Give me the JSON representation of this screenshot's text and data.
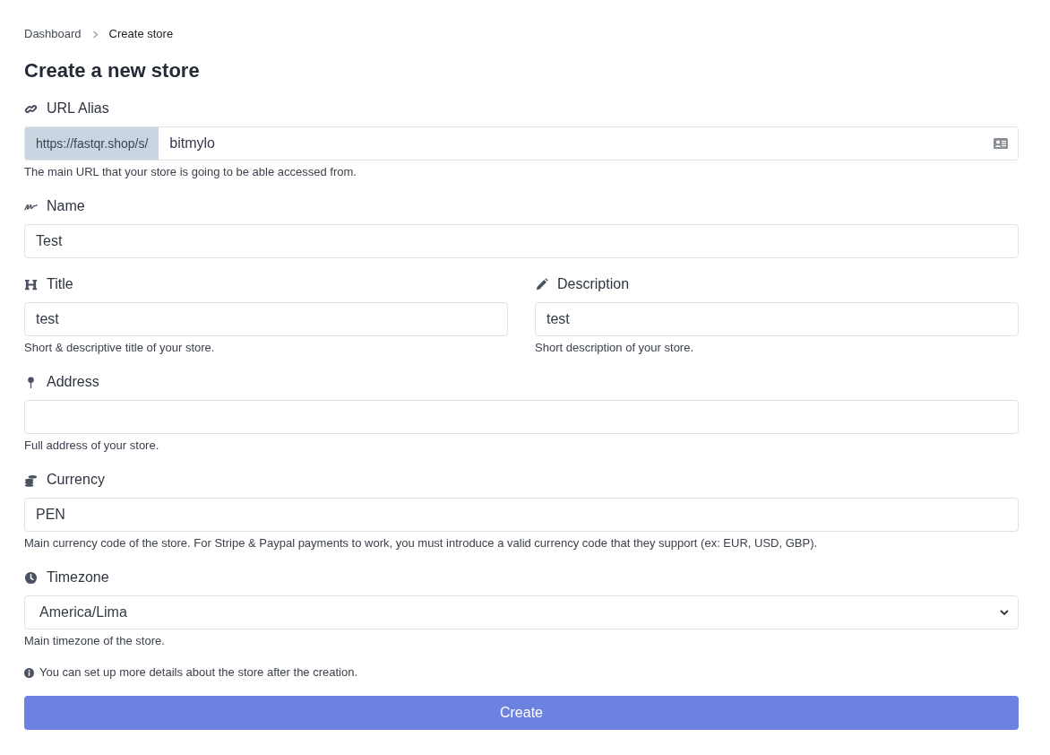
{
  "breadcrumb": [
    {
      "label": "Dashboard",
      "selected": false
    },
    {
      "label": "Create store",
      "selected": true
    }
  ],
  "heading": "Create a new store",
  "url_alias": {
    "label": "URL Alias",
    "prefix": "https://fastqr.shop/s/",
    "value": "bitmylo",
    "help": "The main URL that your store is going to be able accessed from."
  },
  "name": {
    "label": "Name",
    "value": "Test"
  },
  "title": {
    "label": "Title",
    "value": "test",
    "help": "Short & descriptive title of your store."
  },
  "description": {
    "label": "Description",
    "value": "test",
    "help": "Short description of your store."
  },
  "address": {
    "label": "Address",
    "help": "Full address of your store."
  },
  "currency": {
    "label": "Currency",
    "value": "PEN",
    "help": "Main currency code of the store. For Stripe & Paypal payments to work, you must introduce a valid currency code that they support (ex: EUR, USD, GBP)."
  },
  "timezone": {
    "label": "Timezone",
    "value": "America/Lima",
    "help": "Main timezone of the store."
  },
  "note": "You can set up more details about the store after the creation.",
  "submit": "Create"
}
